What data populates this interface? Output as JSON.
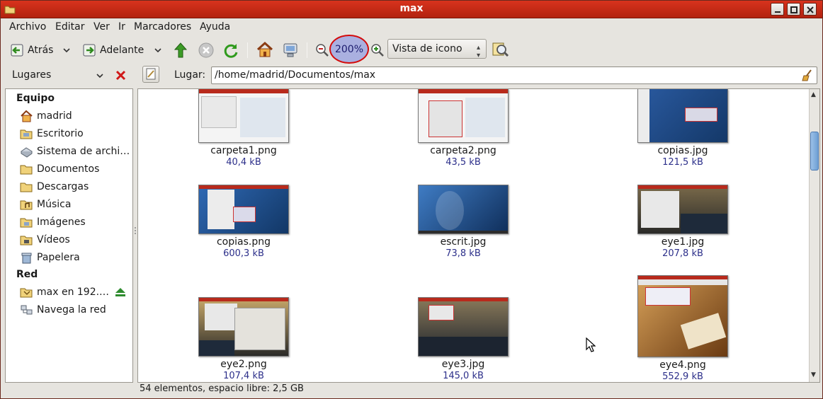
{
  "window": {
    "title": "max"
  },
  "menu": [
    "Archivo",
    "Editar",
    "Ver",
    "Ir",
    "Marcadores",
    "Ayuda"
  ],
  "toolbar": {
    "back": "Atrás",
    "forward": "Adelante",
    "zoom": "200%",
    "view_mode": "Vista de icono"
  },
  "sidebar": {
    "title": "Lugares",
    "sections": [
      {
        "heading": "Equipo",
        "items": [
          "madrid",
          "Escritorio",
          "Sistema de archi…",
          "Documentos",
          "Descargas",
          "Música",
          "Imágenes",
          "Vídeos",
          "Papelera"
        ]
      },
      {
        "heading": "Red",
        "items": [
          "max en 192.…",
          "Navega la red"
        ]
      }
    ]
  },
  "location": {
    "label": "Lugar:",
    "path": "/home/madrid/Documentos/max"
  },
  "files": [
    {
      "name": "carpeta1.png",
      "size": "40,4 kB"
    },
    {
      "name": "carpeta2.png",
      "size": "43,5 kB"
    },
    {
      "name": "copias.jpg",
      "size": "121,5 kB"
    },
    {
      "name": "copias.png",
      "size": "600,3 kB"
    },
    {
      "name": "escrit.jpg",
      "size": "73,8 kB"
    },
    {
      "name": "eye1.jpg",
      "size": "207,8 kB"
    },
    {
      "name": "eye2.png",
      "size": "107,4 kB"
    },
    {
      "name": "eye3.jpg",
      "size": "145,0 kB"
    },
    {
      "name": "eye4.png",
      "size": "552,9 kB"
    }
  ],
  "status": "54 elementos, espacio libre: 2,5 GB",
  "colors": {
    "titlebar": "#c62b16",
    "zoom_highlight": "#aab0e0",
    "zoom_ring": "#d40b0b",
    "size_text": "#2c2f8a"
  }
}
